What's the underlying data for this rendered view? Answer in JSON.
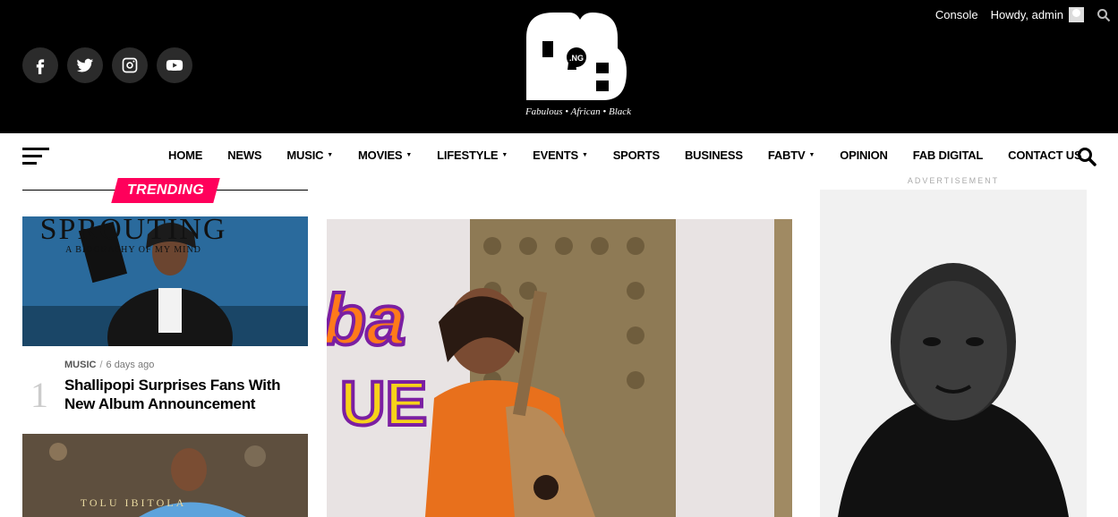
{
  "admin_bar": {
    "console_label": "Console",
    "howdy_label": "Howdy, admin"
  },
  "social": {
    "icons": [
      "facebook-icon",
      "twitter-icon",
      "instagram-icon",
      "youtube-icon"
    ]
  },
  "logo": {
    "letters": "FAB",
    "badge": ".NG",
    "tagline": "Fabulous • African • Black"
  },
  "nav": {
    "items": [
      {
        "label": "HOME",
        "has_dropdown": false
      },
      {
        "label": "NEWS",
        "has_dropdown": false
      },
      {
        "label": "MUSIC",
        "has_dropdown": true
      },
      {
        "label": "MOVIES",
        "has_dropdown": true
      },
      {
        "label": "LIFESTYLE",
        "has_dropdown": true
      },
      {
        "label": "EVENTS",
        "has_dropdown": true
      },
      {
        "label": "SPORTS",
        "has_dropdown": false
      },
      {
        "label": "BUSINESS",
        "has_dropdown": false
      },
      {
        "label": "FABTV",
        "has_dropdown": true
      },
      {
        "label": "OPINION",
        "has_dropdown": false
      },
      {
        "label": "FAB DIGITAL",
        "has_dropdown": false
      },
      {
        "label": "CONTACT US",
        "has_dropdown": false
      }
    ]
  },
  "trending": {
    "label": "TRENDING",
    "accent_color": "#ff005b",
    "items": [
      {
        "rank": "1",
        "category": "MUSIC",
        "time_ago": "6 days ago",
        "title": "Shallipopi Surprises Fans With New Album Announcement"
      }
    ]
  },
  "ad": {
    "label": "ADVERTISEMENT",
    "book_title": "SPROUTING",
    "book_subtitle": "A BIOGRAPHY OF MY MIND",
    "author": "TOLU IBITOLA"
  }
}
